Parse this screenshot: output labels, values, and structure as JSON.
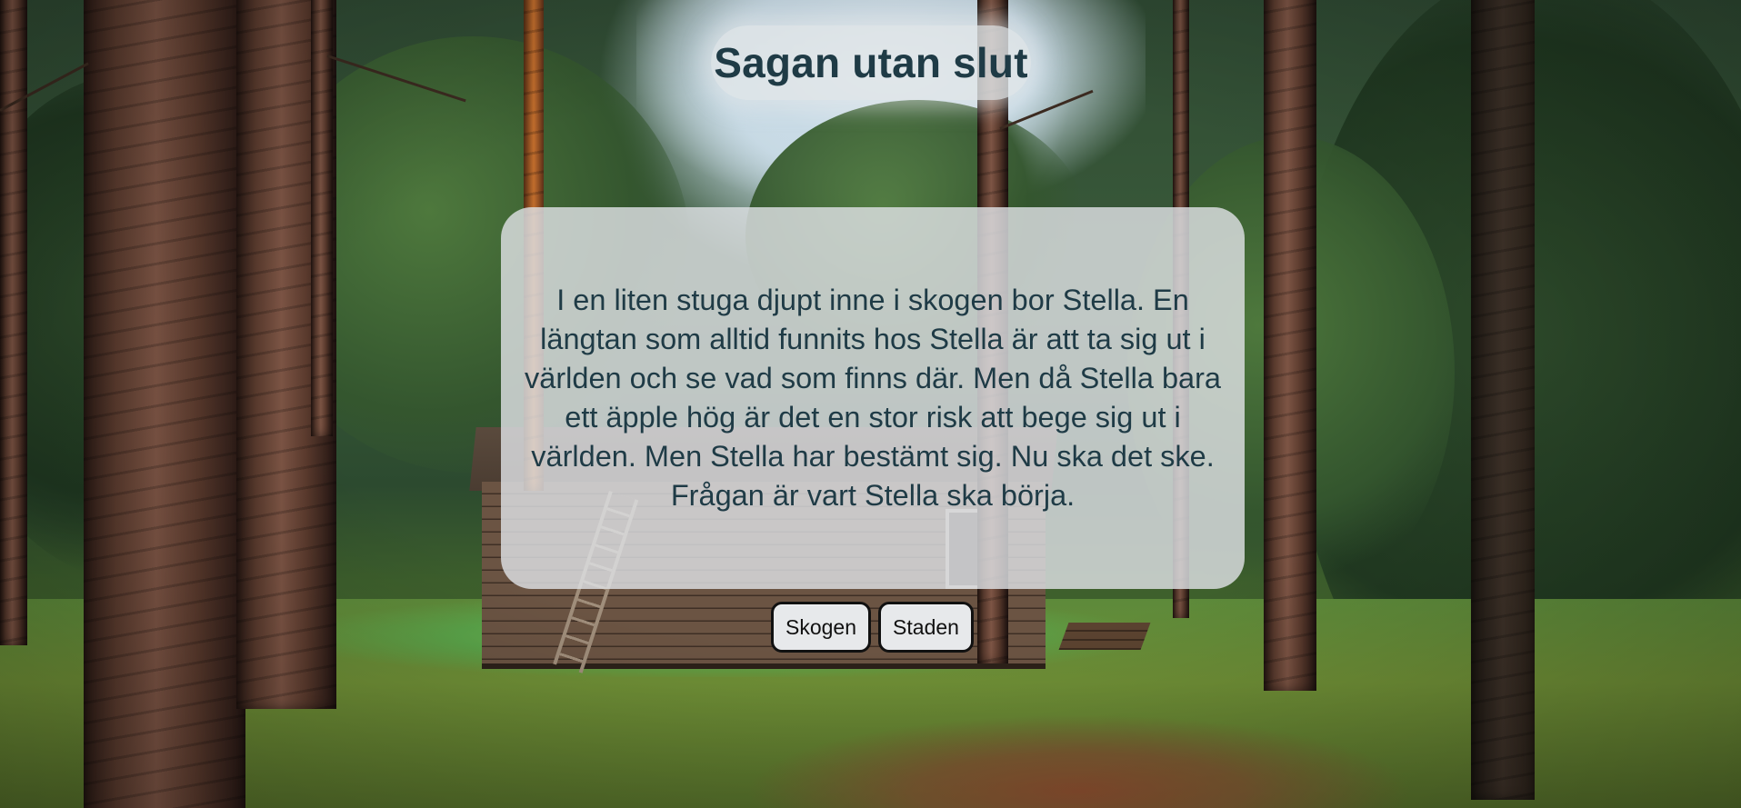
{
  "page": {
    "title": "Sagan utan slut"
  },
  "story": {
    "text": "I en liten stuga djupt inne i skogen bor Stella. En längtan som alltid funnits hos Stella är att ta sig ut i världen och se vad som finns där. Men då Stella bara ett äpple hög är det en stor risk att bege sig ut i världen. Men Stella har bestämt sig. Nu ska det ske. Frågan är vart Stella ska börja."
  },
  "choices": [
    {
      "label": "Skogen"
    },
    {
      "label": "Staden"
    }
  ],
  "colors": {
    "text": "#1f3b46",
    "card_background": "#dee1e4",
    "button_background": "#e7e9eb",
    "button_border": "#111111"
  }
}
